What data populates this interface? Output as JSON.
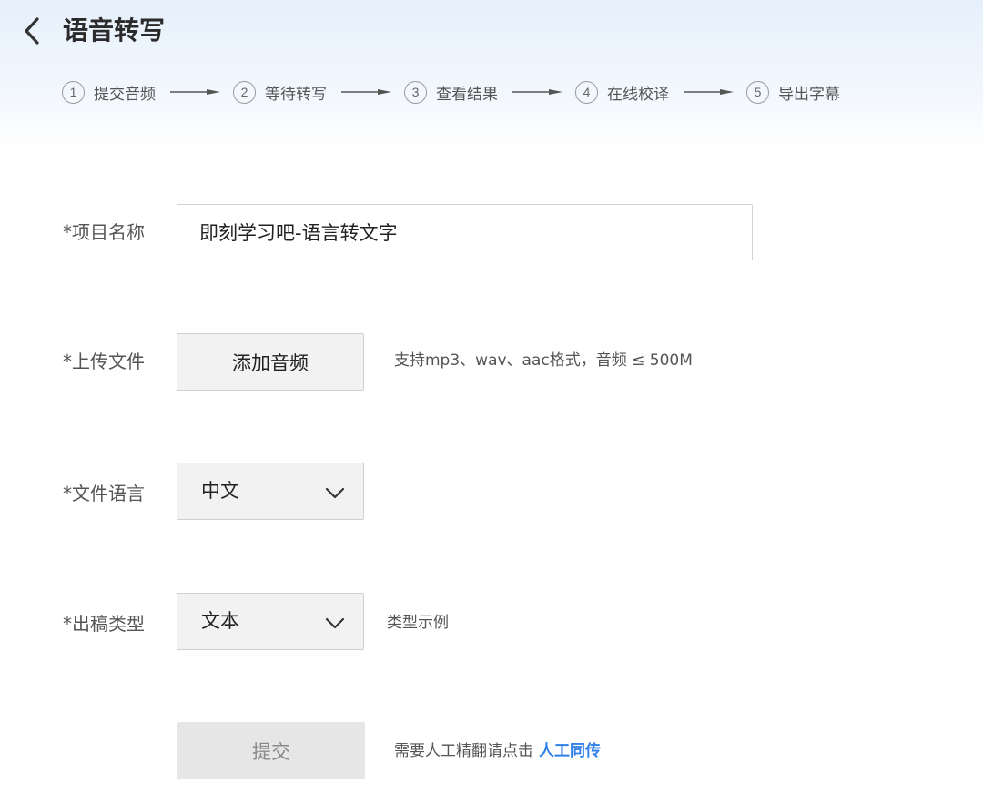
{
  "header": {
    "title": "语音转写",
    "back_icon": "chevron-left-icon"
  },
  "steps": [
    {
      "num": "1",
      "label": "提交音频"
    },
    {
      "num": "2",
      "label": "等待转写"
    },
    {
      "num": "3",
      "label": "查看结果"
    },
    {
      "num": "4",
      "label": "在线校译"
    },
    {
      "num": "5",
      "label": "导出字幕"
    }
  ],
  "form": {
    "project_name": {
      "label": "*项目名称",
      "value": "即刻学习吧-语言转文字"
    },
    "upload": {
      "label": "*上传文件",
      "button": "添加音频",
      "hint": "支持mp3、wav、aac格式，音频 ≤ 500M"
    },
    "language": {
      "label": "*文件语言",
      "selected": "中文"
    },
    "output_type": {
      "label": "*出稿类型",
      "selected": "文本",
      "example_link": "类型示例"
    },
    "submit": {
      "label": "提交",
      "note": "需要人工精翻请点击",
      "link": "人工同传"
    }
  },
  "colors": {
    "accent": "#2f7fe8",
    "header_bg": "#e6f0fb",
    "disabled_button_bg": "#e6e6e6"
  }
}
